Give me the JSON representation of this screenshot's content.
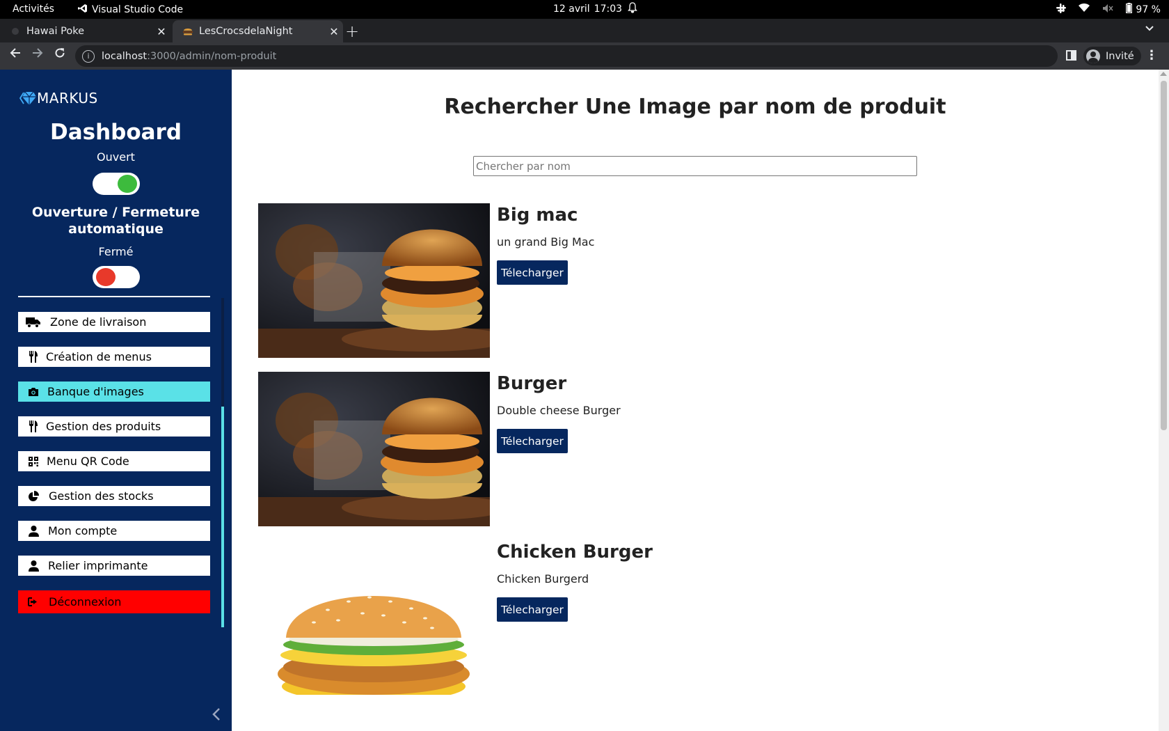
{
  "os": {
    "activities": "Activités",
    "app_name": "Visual Studio Code",
    "date": "12 avril",
    "time": "17:03",
    "battery": "97 %"
  },
  "browser": {
    "tabs": [
      {
        "label": "Hawai Poke"
      },
      {
        "label": "LesCrocsdelaNight"
      }
    ],
    "url_host": "localhost",
    "url_path": ":3000/admin/nom-produit",
    "profile_label": "Invité"
  },
  "sidebar": {
    "brand": "MARKUS",
    "title": "Dashboard",
    "open_status": "Ouvert",
    "auto_title": "Ouverture / Fermeture automatique",
    "closed_status": "Fermé",
    "open_toggle_on": true,
    "auto_toggle_on": false,
    "items": [
      {
        "label": "Zone de livraison",
        "icon": "truck-icon"
      },
      {
        "label": "Création de menus",
        "icon": "utensils-icon"
      },
      {
        "label": "Banque d'images",
        "icon": "camera-icon",
        "active": true
      },
      {
        "label": "Gestion des produits",
        "icon": "utensils-icon"
      },
      {
        "label": "Menu QR Code",
        "icon": "qrcode-icon"
      },
      {
        "label": "Gestion des stocks",
        "icon": "pie-chart-icon"
      },
      {
        "label": "Mon compte",
        "icon": "user-icon"
      },
      {
        "label": "Relier imprimante",
        "icon": "user-icon"
      }
    ],
    "logout_label": "Déconnexion"
  },
  "main": {
    "title": "Rechercher Une Image par nom de produit",
    "search_placeholder": "Chercher par nom",
    "products": [
      {
        "name": "Big mac",
        "description": "un grand Big Mac",
        "button": "Télecharger"
      },
      {
        "name": "Burger",
        "description": "Double cheese Burger",
        "button": "Télecharger"
      },
      {
        "name": "Chicken Burger",
        "description": "Chicken Burgerd",
        "button": "Télecharger"
      }
    ]
  },
  "colors": {
    "sidebar_bg": "#06275e",
    "active_item": "#5ae1e7",
    "logout": "#ff0000",
    "toggle_on": "#3dbb3d",
    "toggle_off": "#e8392a",
    "button_bg": "#06275e"
  }
}
